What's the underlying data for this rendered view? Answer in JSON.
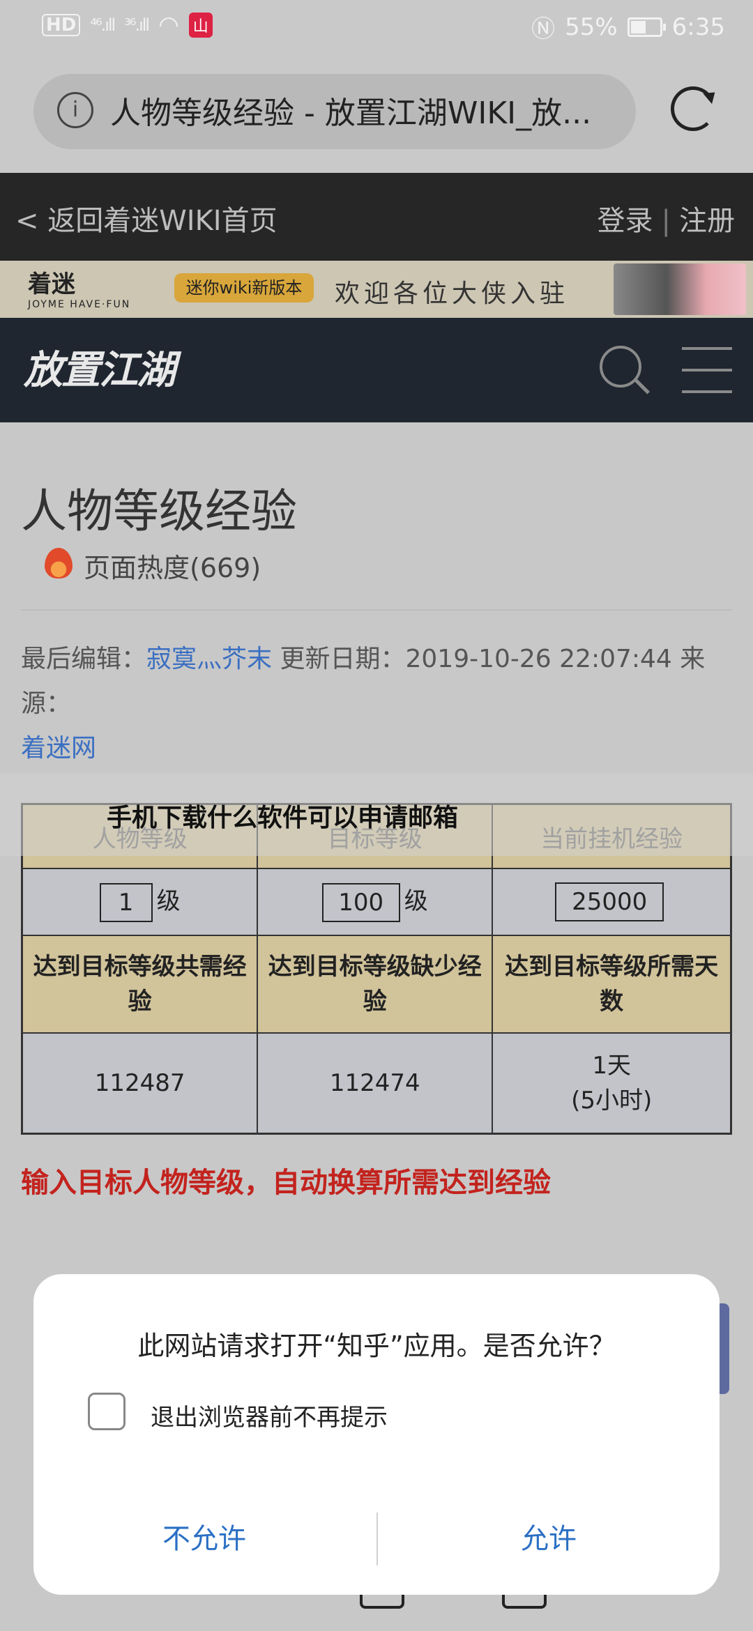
{
  "status_bar": {
    "network_hd": "HD",
    "signal_1": "⁴⁶.ıll",
    "signal_2": "³⁶.ıll",
    "app_badge": "山",
    "battery_percent": "55%",
    "battery_level": 0.55,
    "time": "6:35"
  },
  "url_bar": {
    "url_text": "人物等级经验 - 放置江湖WIKI_放..."
  },
  "site_header": {
    "back_link": "< 返回着迷WIKI首页",
    "login": "登录",
    "separator": "|",
    "register": "注册"
  },
  "banner": {
    "logo": "着迷",
    "logo_sub": "JOYME HAVE·FUN",
    "pill": "迷你wiki新版本",
    "welcome": "欢迎各位大侠入驻"
  },
  "game_header": {
    "logo": "放置江湖"
  },
  "article": {
    "title": "人物等级经验",
    "heat": "页面热度(669)",
    "last_edit_label": "最后编辑：",
    "editor": "寂寞灬芥末",
    "update_label": " 更新日期：2019-10-26 22:07:44  来源：",
    "source": "着迷网"
  },
  "overlay": {
    "text": "手机下载什么软件可以申请邮箱"
  },
  "calculator": {
    "headers": [
      "人物等级",
      "目标等级",
      "当前挂机经验"
    ],
    "current_level": "1",
    "target_level": "100",
    "idle_exp": "25000",
    "level_unit": "级",
    "result_labels": [
      "达到目标等级共需经验",
      "达到目标等级缺少经验",
      "达到目标等级所需天数"
    ],
    "total_exp": "112487",
    "missing_exp": "112474",
    "days_line1": "1天",
    "days_line2": "(5小时)",
    "hint": "输入目标人物等级，自动换算所需达到经验"
  },
  "dialog": {
    "message": "此网站请求打开“知乎”应用。是否允许？",
    "checkbox_label": "退出浏览器前不再提示",
    "deny": "不允许",
    "allow": "允许"
  },
  "colors": {
    "link": "#3b6fc2",
    "hint_red": "#c3231e",
    "table_header": "#d1c39a",
    "table_cell": "#c2c4ca",
    "dialog_button": "#2a6fc4"
  }
}
